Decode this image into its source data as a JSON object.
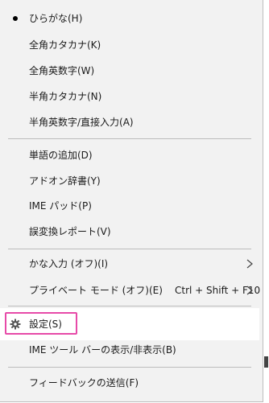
{
  "menu": {
    "items": [
      {
        "label": "ひらがな(H)",
        "selected": true
      },
      {
        "label": "全角カタカナ(K)"
      },
      {
        "label": "全角英数字(W)"
      },
      {
        "label": "半角カタカナ(N)"
      },
      {
        "label": "半角英数字/直接入力(A)"
      },
      {
        "label": "単語の追加(D)"
      },
      {
        "label": "アドオン辞書(Y)"
      },
      {
        "label": "IME パッド(P)"
      },
      {
        "label": "誤変換レポート(V)"
      },
      {
        "label": "かな入力 (オフ)(I)",
        "icon": "chevron-right-icon"
      },
      {
        "label": "プライベート モード (オフ)(E)",
        "shortcut": "Ctrl + Shift + F10",
        "icon": "chevron-right-icon"
      },
      {
        "label": "設定(S)",
        "icon": "gear-icon"
      },
      {
        "label": "IME ツール バーの表示/非表示(B)"
      },
      {
        "label": "フィードバックの送信(F)"
      }
    ]
  },
  "colors": {
    "menu_background": "#f2f2f2",
    "hover_background": "#ffffff",
    "highlight_border": "#e74aa8"
  }
}
